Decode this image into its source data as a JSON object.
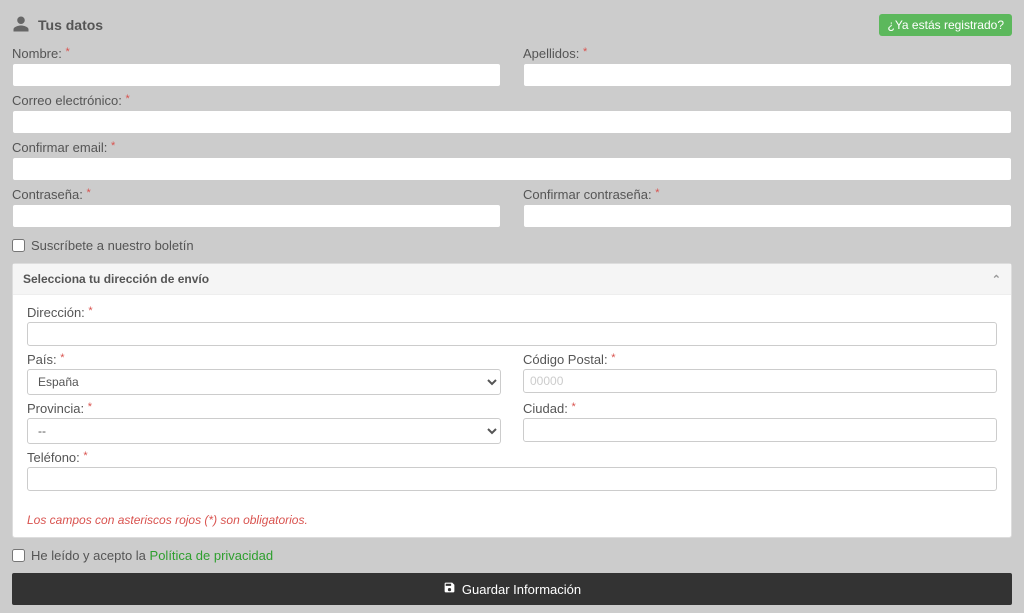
{
  "header": {
    "title": "Tus datos",
    "registered": "¿Ya estás registrado?"
  },
  "fields": {
    "nombre": "Nombre:",
    "apellidos": "Apellidos:",
    "correo": "Correo electrónico:",
    "confirmar_email": "Confirmar email:",
    "contrasena": "Contraseña:",
    "confirmar_contrasena": "Confirmar contraseña:",
    "direccion": "Dirección:",
    "pais": "País:",
    "codigo_postal": "Código Postal:",
    "cp_placeholder": "00000",
    "provincia": "Provincia:",
    "ciudad": "Ciudad:",
    "telefono": "Teléfono:"
  },
  "newsletter": "Suscríbete a nuestro boletín",
  "panel": {
    "title": "Selecciona tu dirección de envío"
  },
  "selects": {
    "pais_value": "España",
    "provincia_value": "--"
  },
  "note": "Los campos con asteriscos rojos (*) son obligatorios.",
  "privacy": {
    "pre": "He leído y acepto la ",
    "link": "Política de privacidad"
  },
  "save": "Guardar Información"
}
